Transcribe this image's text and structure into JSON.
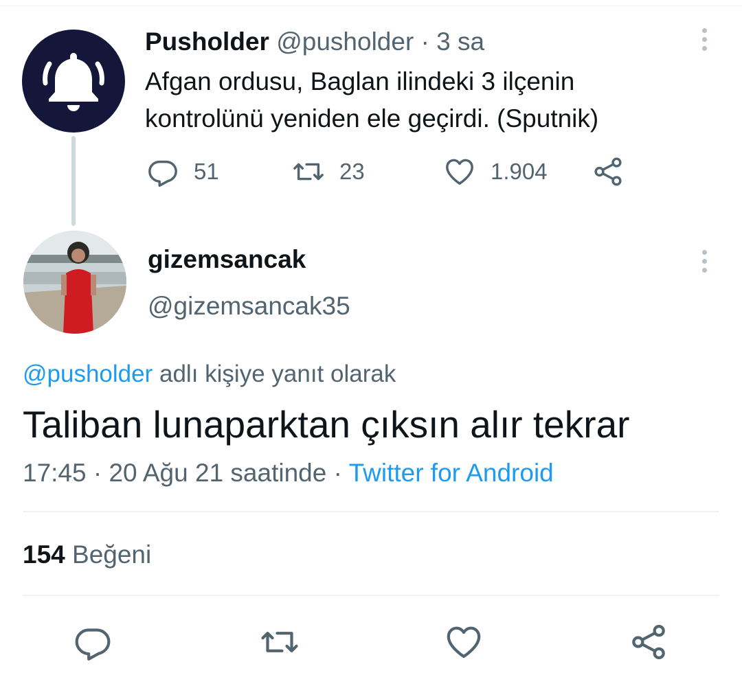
{
  "parent_tweet": {
    "author_name": "Pusholder",
    "author_handle": "@pusholder",
    "separator": "·",
    "time_ago": "3 sa",
    "text": "Afgan ordusu, Baglan ilindeki 3 ilçenin kontrolünü yeniden ele geçirdi. (Sputnik)",
    "reply_count": "51",
    "retweet_count": "23",
    "like_count": "1.904"
  },
  "reply_tweet": {
    "author_name": "gizemsancak",
    "author_handle": "@gizemsancak35",
    "replying_to_mention": "@pusholder",
    "replying_to_suffix": "adlı kişiye yanıt olarak",
    "text": "Taliban lunaparktan çıksın alır tekrar",
    "time": "17:45",
    "date": "20 Ağu 21 saatinde",
    "separator": "·",
    "source": "Twitter for Android",
    "like_count": "154",
    "like_label": "Beğeni"
  },
  "icons": {
    "avatar_pusholder": "bell-icon",
    "reply": "reply-icon",
    "retweet": "retweet-icon",
    "like": "heart-icon",
    "share": "share-icon",
    "more": "more-vertical-icon"
  },
  "colors": {
    "link": "#1d9bf0",
    "secondary_text": "#536471",
    "primary_text": "#0f1419",
    "avatar_bg": "#14163a",
    "divider": "#eff3f4"
  }
}
